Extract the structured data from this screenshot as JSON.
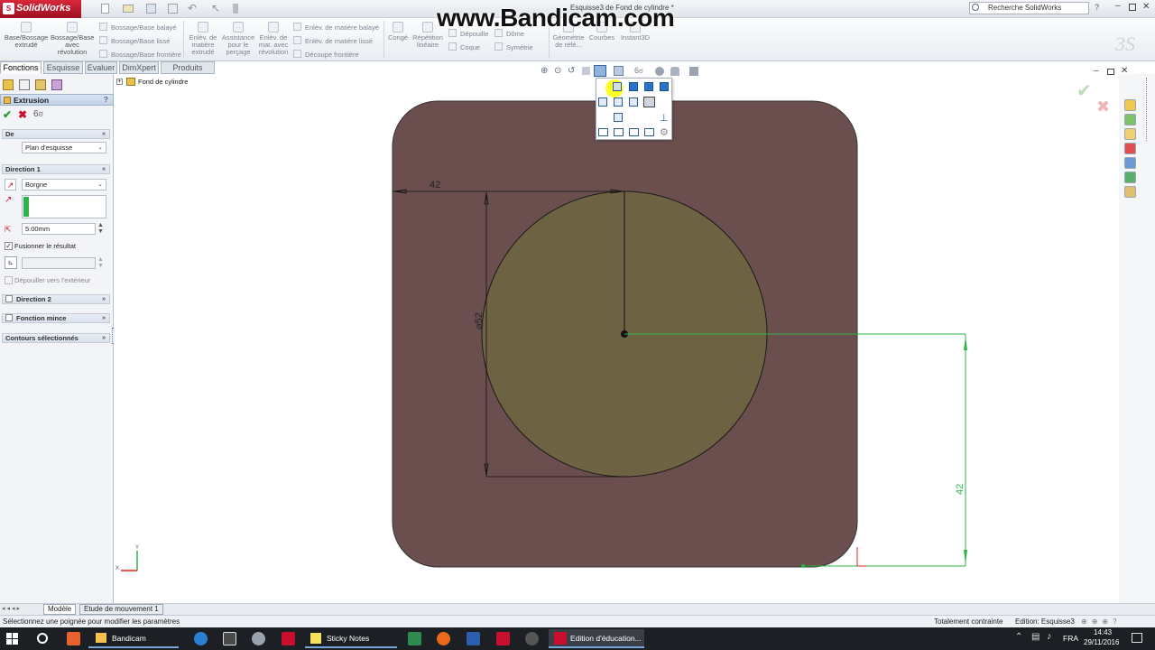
{
  "app": {
    "name": "SolidWorks",
    "doc_title": "Esquisse3 de Fond de cylindre *",
    "search_placeholder": "Recherche SolidWorks",
    "watermark": "www.Bandicam.com"
  },
  "ribbon": {
    "extrude_boss": "Base/Bossage extrudé",
    "revolve_boss": "Bossage/Base avec révolution",
    "swept_boss": "Bossage/Base balayé",
    "lofted_boss": "Bossage/Base lissé",
    "boundary_boss": "Bossage/Base frontière",
    "extruded_cut": "Enlèv. de matière extrudé",
    "hole_wizard": "Assistance pour le perçage",
    "revolved_cut": "Enlèv. de mat. avec révolution",
    "swept_cut": "Enlèv. de matière balayé",
    "lofted_cut": "Enlèv. de matière lissé",
    "boundary_cut": "Découpe frontière",
    "fillet": "Congé",
    "linear_pattern": "Répétition linéaire",
    "draft": "Dépouille",
    "shell": "Coque",
    "dome": "Dôme",
    "mirror": "Symétrie",
    "ref_geometry": "Géométrie de réfé...",
    "curves": "Courbes",
    "instant3d": "Instant3D"
  },
  "tabs": [
    "Fonctions",
    "Esquisse",
    "Evaluer",
    "DimXpert",
    "Produits Office"
  ],
  "panel": {
    "title": "Extrusion",
    "help": "?",
    "from_label": "De",
    "from_value": "Plan d'esquisse",
    "dir1_label": "Direction 1",
    "end_condition": "Borgne",
    "depth": "5.00mm",
    "merge_label": "Fusionner le résultat",
    "draft_out_label": "Dépouiller vers l'extérieur",
    "dir2_label": "Direction 2",
    "thin_label": "Fonction mince",
    "contours_label": "Contours sélectionnés"
  },
  "tree": {
    "part_name": "Fond de cylindre"
  },
  "sketch": {
    "dim_horizontal": "42",
    "dim_diameter": "⌀52",
    "dim_vertical": "42"
  },
  "bottom_tabs": [
    "Modèle",
    "Etude de mouvement 1"
  ],
  "status": {
    "message": "Sélectionnez une poignée pour modifier les paramètres",
    "constraint": "Totalement contrainte",
    "edit_mode": "Edition: Esquisse3"
  },
  "taskbar": {
    "apps": [
      {
        "label": "Bandicam"
      },
      {
        "label": "Sticky Notes"
      },
      {
        "label": "Edition d'éducation..."
      }
    ],
    "lang": "FRA",
    "time": "14:43",
    "date": "29/11/2016"
  },
  "colors": {
    "part_body": "#6b4f4f",
    "circle_fill": "#6d6242",
    "sketch_green": "#2db34a",
    "accent": "#c8102e"
  }
}
